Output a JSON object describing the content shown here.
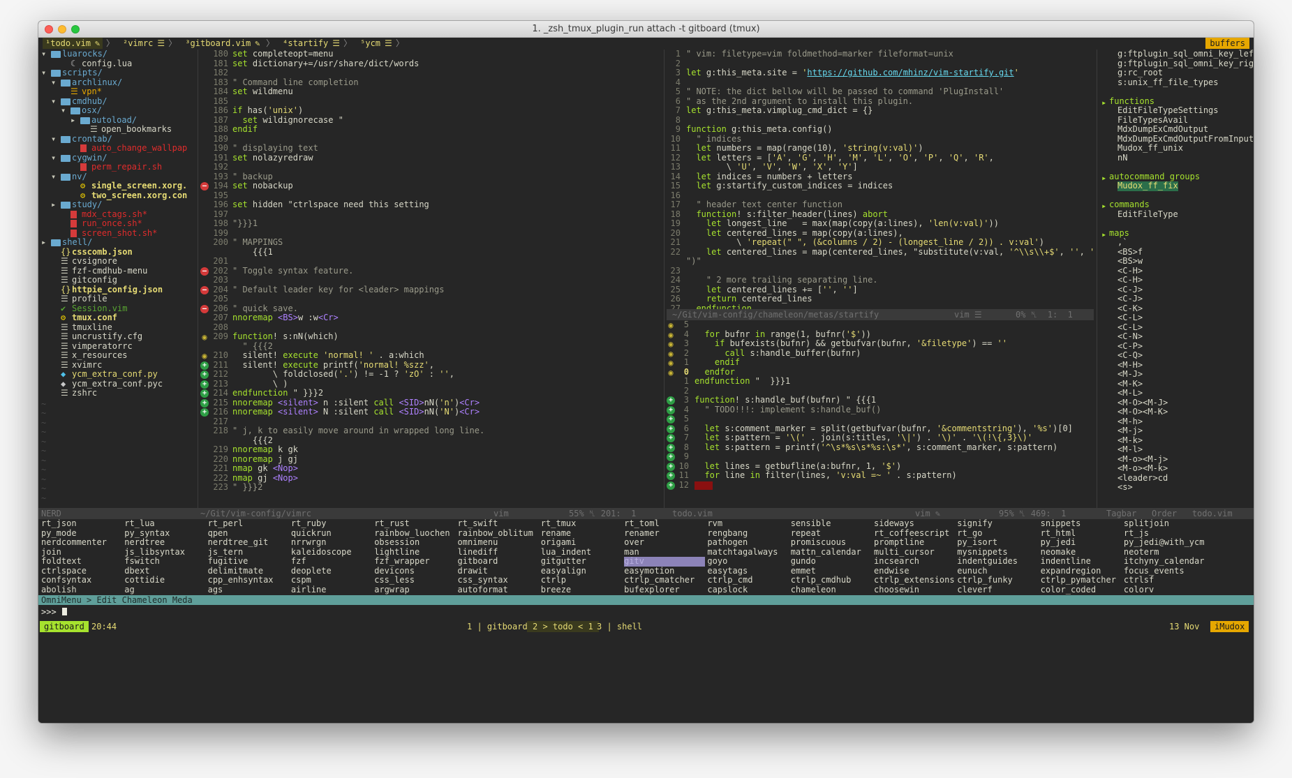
{
  "window": {
    "title": "1. _zsh_tmux_plugin_run attach -t gitboard (tmux)"
  },
  "tabline": {
    "tabs": [
      {
        "label": "¹todo.vim",
        "icon": "✎",
        "active": true
      },
      {
        "label": "²vimrc",
        "icon": "☰",
        "active": false
      },
      {
        "label": "³gitboard.vim",
        "icon": "✎",
        "active": false
      },
      {
        "label": "⁴startify",
        "icon": "☰",
        "active": false
      },
      {
        "label": "⁵ycm",
        "icon": "☰",
        "active": false
      }
    ],
    "right_label": "buffers"
  },
  "nerdtree": {
    "rows": [
      {
        "indent": 0,
        "arrow": "▾",
        "kind": "folder",
        "label": "luarocks/"
      },
      {
        "indent": 2,
        "arrow": "",
        "kind": "lua",
        "label": "config.lua"
      },
      {
        "indent": 0,
        "arrow": "▾",
        "kind": "folder",
        "label": "scripts/"
      },
      {
        "indent": 1,
        "arrow": "▾",
        "kind": "folder",
        "label": "archlinux/"
      },
      {
        "indent": 2,
        "arrow": "",
        "kind": "doc-y",
        "label": "vpn*"
      },
      {
        "indent": 1,
        "arrow": "▾",
        "kind": "folder",
        "label": "cmdhub/"
      },
      {
        "indent": 2,
        "arrow": "▾",
        "kind": "folder",
        "label": "osx/"
      },
      {
        "indent": 3,
        "arrow": "▸",
        "kind": "folder",
        "label": "autoload/"
      },
      {
        "indent": 4,
        "arrow": "",
        "kind": "doc",
        "label": "open_bookmarks"
      },
      {
        "indent": 1,
        "arrow": "▾",
        "kind": "folder",
        "label": "crontab/"
      },
      {
        "indent": 3,
        "arrow": "",
        "kind": "red",
        "label": "auto_change_wallpap"
      },
      {
        "indent": 1,
        "arrow": "▾",
        "kind": "folder",
        "label": "cygwin/"
      },
      {
        "indent": 3,
        "arrow": "",
        "kind": "red",
        "label": "perm_repair.sh"
      },
      {
        "indent": 1,
        "arrow": "▾",
        "kind": "folder",
        "label": "nv/"
      },
      {
        "indent": 3,
        "arrow": "",
        "kind": "gear",
        "label": "single_screen.xorg."
      },
      {
        "indent": 3,
        "arrow": "",
        "kind": "gear",
        "label": "two_screen.xorg.con"
      },
      {
        "indent": 1,
        "arrow": "▸",
        "kind": "folder",
        "label": "study/"
      },
      {
        "indent": 2,
        "arrow": "",
        "kind": "red",
        "label": "mdx_ctags.sh*"
      },
      {
        "indent": 2,
        "arrow": "",
        "kind": "red",
        "label": "run_once.sh*"
      },
      {
        "indent": 2,
        "arrow": "",
        "kind": "red",
        "label": "screen_shot.sh*"
      },
      {
        "indent": 0,
        "arrow": "▸",
        "kind": "folder",
        "label": "shell/"
      },
      {
        "indent": 1,
        "arrow": "",
        "kind": "json",
        "label": "csscomb.json"
      },
      {
        "indent": 1,
        "arrow": "",
        "kind": "doc",
        "label": "cvsignore"
      },
      {
        "indent": 1,
        "arrow": "",
        "kind": "doc",
        "label": "fzf-cmdhub-menu"
      },
      {
        "indent": 1,
        "arrow": "",
        "kind": "doc",
        "label": "gitconfig"
      },
      {
        "indent": 1,
        "arrow": "",
        "kind": "json",
        "label": "httpie_config.json"
      },
      {
        "indent": 1,
        "arrow": "",
        "kind": "doc",
        "label": "profile"
      },
      {
        "indent": 1,
        "arrow": "",
        "kind": "vim",
        "label": "Session.vim"
      },
      {
        "indent": 1,
        "arrow": "",
        "kind": "gear",
        "label": "tmux.conf"
      },
      {
        "indent": 1,
        "arrow": "",
        "kind": "doc",
        "label": "tmuxline"
      },
      {
        "indent": 1,
        "arrow": "",
        "kind": "doc",
        "label": "uncrustify.cfg"
      },
      {
        "indent": 1,
        "arrow": "",
        "kind": "doc",
        "label": "vimperatorrc"
      },
      {
        "indent": 1,
        "arrow": "",
        "kind": "doc",
        "label": "x_resources"
      },
      {
        "indent": 1,
        "arrow": "",
        "kind": "doc",
        "label": "xvimrc"
      },
      {
        "indent": 1,
        "arrow": "",
        "kind": "py",
        "label": "ycm_extra_conf.py"
      },
      {
        "indent": 1,
        "arrow": "",
        "kind": "py2",
        "label": "ycm_extra_conf.pyc"
      },
      {
        "indent": 1,
        "arrow": "",
        "kind": "doc",
        "label": "zshrc"
      }
    ],
    "tildes": [
      "~",
      "~",
      "~",
      "~",
      "~",
      "~",
      "~",
      "~",
      "~",
      "~",
      "~"
    ],
    "status": "NERD"
  },
  "vimrc": {
    "lines": [
      {
        "n": "180",
        "s": "",
        "t": "set completeopt=menu"
      },
      {
        "n": "181",
        "s": "",
        "t": "set dictionary+=/usr/share/dict/words"
      },
      {
        "n": "182",
        "s": "",
        "t": ""
      },
      {
        "n": "183",
        "s": "",
        "t": "\" Command line completion"
      },
      {
        "n": "184",
        "s": "",
        "t": "set wildmenu"
      },
      {
        "n": "185",
        "s": "",
        "t": ""
      },
      {
        "n": "186",
        "s": "",
        "t": "if has('unix')"
      },
      {
        "n": "187",
        "s": "",
        "t": "  set wildignorecase \""
      },
      {
        "n": "188",
        "s": "",
        "t": "endif"
      },
      {
        "n": "189",
        "s": "",
        "t": ""
      },
      {
        "n": "190",
        "s": "",
        "t": "\" displaying text"
      },
      {
        "n": "191",
        "s": "",
        "t": "set nolazyredraw"
      },
      {
        "n": "192",
        "s": "",
        "t": ""
      },
      {
        "n": "193",
        "s": "",
        "t": "\" backup"
      },
      {
        "n": "194",
        "s": "r",
        "t": "set nobackup"
      },
      {
        "n": "195",
        "s": "",
        "t": ""
      },
      {
        "n": "196",
        "s": "",
        "t": "set hidden \"ctrlspace need this setting"
      },
      {
        "n": "197",
        "s": "",
        "t": ""
      },
      {
        "n": "198",
        "s": "",
        "t": "\"}}}1"
      },
      {
        "n": "199",
        "s": "",
        "t": ""
      },
      {
        "n": "200",
        "s": "",
        "t": "\" MAPPINGS"
      },
      {
        "n": "",
        "s": "",
        "t": "    {{{1"
      },
      {
        "n": "201",
        "s": "",
        "t": ""
      },
      {
        "n": "202",
        "s": "r",
        "t": "\" Toggle syntax feature."
      },
      {
        "n": "203",
        "s": "",
        "t": ""
      },
      {
        "n": "204",
        "s": "r",
        "t": "\" Default leader key for <leader> mappings"
      },
      {
        "n": "205",
        "s": "",
        "t": ""
      },
      {
        "n": "206",
        "s": "r",
        "t": "\" quick save."
      },
      {
        "n": "207",
        "s": "",
        "t": "nnoremap <BS>w :w<Cr>"
      },
      {
        "n": "208",
        "s": "",
        "t": ""
      },
      {
        "n": "209",
        "s": "e",
        "t": "function! s:nN(which)"
      },
      {
        "n": "",
        "s": "",
        "t": "  \" {{{2"
      },
      {
        "n": "210",
        "s": "e",
        "t": "  silent! execute 'normal! ' . a:which"
      },
      {
        "n": "211",
        "s": "g",
        "t": "  silent! execute printf('normal! %szz',"
      },
      {
        "n": "212",
        "s": "g",
        "t": "        \\ foldclosed('.') != -1 ? 'zO' : '',"
      },
      {
        "n": "213",
        "s": "g",
        "t": "        \\ )"
      },
      {
        "n": "214",
        "s": "g",
        "t": "endfunction \" }}}2"
      },
      {
        "n": "215",
        "s": "g",
        "t": "nnoremap <silent> n :silent call <SID>nN('n')<Cr>"
      },
      {
        "n": "216",
        "s": "g",
        "t": "nnoremap <silent> N :silent call <SID>nN('N')<Cr>"
      },
      {
        "n": "217",
        "s": "",
        "t": ""
      },
      {
        "n": "218",
        "s": "",
        "t": "\" j, k to easily move around in wrapped long line."
      },
      {
        "n": "",
        "s": "",
        "t": "    {{{2"
      },
      {
        "n": "219",
        "s": "",
        "t": "nnoremap k gk"
      },
      {
        "n": "220",
        "s": "",
        "t": "nnoremap j gj"
      },
      {
        "n": "221",
        "s": "",
        "t": "nmap gk <Nop>"
      },
      {
        "n": "222",
        "s": "",
        "t": "nmap gj <Nop>"
      },
      {
        "n": "223",
        "s": "",
        "t": "\" }}}2"
      }
    ],
    "status_path": "~/Git/vim-config/vimrc",
    "status_ft": "vim",
    "status_pos": "55% ␤ 201:  1"
  },
  "startify_meta": {
    "lines": [
      {
        "n": "1",
        "t": "\" vim: filetype=vim foldmethod=marker fileformat=unix"
      },
      {
        "n": "2",
        "t": ""
      },
      {
        "n": "3",
        "t": "let g:this_meta.site = 'https://github.com/mhinz/vim-startify.git'"
      },
      {
        "n": "4",
        "t": ""
      },
      {
        "n": "5",
        "t": "\" NOTE: the dict bellow will be passed to command 'PlugInstall'"
      },
      {
        "n": "6",
        "t": "\" as the 2nd argument to install this plugin."
      },
      {
        "n": "7",
        "t": "let g:this_meta.vimplug_cmd_dict = {}"
      },
      {
        "n": "8",
        "t": ""
      },
      {
        "n": "9",
        "t": "function g:this_meta.config()"
      },
      {
        "n": "10",
        "t": "  \" indices"
      },
      {
        "n": "11",
        "t": "  let numbers = map(range(10), 'string(v:val)')"
      },
      {
        "n": "12",
        "t": "  let letters = ['A', 'G', 'H', 'M', 'L', 'O', 'P', 'Q', 'R',"
      },
      {
        "n": "13",
        "t": "        \\ 'U', 'V', 'W', 'X', 'Y']"
      },
      {
        "n": "14",
        "t": "  let indices = numbers + letters"
      },
      {
        "n": "15",
        "t": "  let g:startify_custom_indices = indices"
      },
      {
        "n": "16",
        "t": ""
      },
      {
        "n": "17",
        "t": "  \" header text center function"
      },
      {
        "n": "18",
        "t": "  function! s:filter_header(lines) abort"
      },
      {
        "n": "19",
        "t": "    let longest_line   = max(map(copy(a:lines), 'len(v:val)'))"
      },
      {
        "n": "20",
        "t": "    let centered_lines = map(copy(a:lines),"
      },
      {
        "n": "21",
        "t": "          \\ 'repeat(\" \", (&columns / 2) - (longest_line / 2)) . v:val')"
      },
      {
        "n": "22",
        "t": "    let centered_lines = map(centered_lines, \"substitute(v:val, '^\\\\s\\\\+$', '', '')"
      },
      {
        "n": "",
        "t": "\")\""
      },
      {
        "n": "23",
        "t": ""
      },
      {
        "n": "24",
        "t": "    \" 2 more trailing separating line."
      },
      {
        "n": "25",
        "t": "    let centered_lines += ['', '']"
      },
      {
        "n": "26",
        "t": "    return centered_lines"
      },
      {
        "n": "27",
        "t": "  endfunction"
      }
    ],
    "status_path": "~/Git/vim-config/chameleon/metas/startify",
    "status_ft": "vim ☰",
    "status_pos": "0% ␤  1:  1"
  },
  "todo": {
    "lines": [
      {
        "n": "5",
        "s": "e",
        "t": ""
      },
      {
        "n": "4",
        "s": "e",
        "t": "  for bufnr in range(1, bufnr('$'))"
      },
      {
        "n": "3",
        "s": "e",
        "t": "    if bufexists(bufnr) && getbufvar(bufnr, '&filetype') == ''"
      },
      {
        "n": "2",
        "s": "e",
        "t": "      call s:handle_buffer(bufnr)"
      },
      {
        "n": "1",
        "s": "e",
        "t": "    endif"
      },
      {
        "n": "0",
        "s": "e",
        "t": "  endfor"
      },
      {
        "n": "1",
        "s": "",
        "t": "endfunction \"  }}}1"
      },
      {
        "n": "2",
        "s": "",
        "t": ""
      },
      {
        "n": "3",
        "s": "g",
        "t": "function! s:handle_buf(bufnr) \" {{{1"
      },
      {
        "n": "4",
        "s": "g",
        "t": "  \" TODO!!!: implement s:handle_buf()"
      },
      {
        "n": "5",
        "s": "g",
        "t": ""
      },
      {
        "n": "6",
        "s": "g",
        "t": "  let s:comment_marker = split(getbufvar(bufnr, '&commentstring'), '%s')[0]"
      },
      {
        "n": "7",
        "s": "g",
        "t": "  let s:pattern = '\\(' . join(s:titles, '\\|') . '\\)' . '\\(!\\{,3}\\)'"
      },
      {
        "n": "8",
        "s": "g",
        "t": "  let s:pattern = printf('^\\s*%s\\s*%s:\\s*', s:comment_marker, s:pattern)"
      },
      {
        "n": "9",
        "s": "g",
        "t": ""
      },
      {
        "n": "10",
        "s": "g",
        "t": "  let lines = getbufline(a:bufnr, 1, '$')"
      },
      {
        "n": "11",
        "s": "g",
        "t": "  for line in filter(lines, 'v:val =~ ' . s:pattern)"
      },
      {
        "n": "12",
        "s": "g",
        "t": ""
      }
    ],
    "status_path": "todo.vim",
    "status_ft": "vim ✎",
    "status_pos": "95% ␤ 469:  1"
  },
  "tagbar": {
    "top_items": [
      "g:ftplugin_sql_omni_key_left",
      "g:ftplugin_sql_omni_key_right",
      "g:rc_root",
      "s:unix_ff_file_types"
    ],
    "functions_label": "functions",
    "functions": [
      "EditFileTypeSettings",
      "FileTypesAvail",
      "MdxDumpExCmdOutput",
      "MdxDumpExCmdOutputFromInput",
      "Mudox_ff_unix",
      "nN"
    ],
    "autocmd_label": "autocommand groups",
    "autocmd": [
      "Mudox_ff_fix"
    ],
    "commands_label": "commands",
    "commands": [
      "EditFileType"
    ],
    "maps_label": "maps",
    "maps": [
      ",`",
      "<BS>f",
      "<BS>w",
      "<C-H>",
      "<C-H>",
      "<C-J>",
      "<C-J>",
      "<C-K>",
      "<C-L>",
      "<C-L>",
      "<C-N>",
      "<C-P>",
      "<C-Q>",
      "<M-H>",
      "<M-J>",
      "<M-K>",
      "<M-L>",
      "<M-O><M-J>",
      "<M-O><M-K>",
      "<M-h>",
      "<M-j>",
      "<M-k>",
      "<M-l>",
      "<M-o><M-j>",
      "<M-o><M-k>",
      "<leader>cd",
      "<s>"
    ],
    "status": "Tagbar   Order   todo.vim"
  },
  "plugins": {
    "columns": [
      [
        "rt_json",
        "py_mode",
        "nerdcommenter",
        "join",
        "foldtext",
        "ctrlspace",
        "confsyntax",
        "abolish"
      ],
      [
        "rt_lua",
        "py_syntax",
        "nerdtree",
        "js_libsyntax",
        "fswitch",
        "dbext",
        "cottidie",
        "ag"
      ],
      [
        "rt_perl",
        "qpen",
        "nerdtree_git",
        "js_tern",
        "fugitive",
        "delimitmate",
        "cpp_enhsyntax",
        "ags"
      ],
      [
        "rt_ruby",
        "quickrun",
        "nrrwrgn",
        "kaleidoscope",
        "fzf",
        "deoplete",
        "cspm",
        "airline"
      ],
      [
        "rt_rust",
        "rainbow_luochen",
        "obsession",
        "lightline",
        "fzf_wrapper",
        "devicons",
        "css_less",
        "argwrap"
      ],
      [
        "rt_swift",
        "rainbow_oblitum",
        "omnimenu",
        "linediff",
        "gitboard",
        "drawit",
        "css_syntax",
        "autoformat"
      ],
      [
        "rt_tmux",
        "rename",
        "origami",
        "lua_indent",
        "gitgutter",
        "easyalign",
        "ctrlp",
        "breeze"
      ],
      [
        "rt_toml",
        "renamer",
        "over",
        "man",
        "gitv",
        "easymotion",
        "ctrlp_cmatcher",
        "bufexplorer"
      ],
      [
        "rvm",
        "rengbang",
        "pathogen",
        "matchtagalways",
        "goyo",
        "easytags",
        "ctrlp_cmd",
        "capslock"
      ],
      [
        "sensible",
        "repeat",
        "promiscuous",
        "mattn_calendar",
        "gundo",
        "emmet",
        "ctrlp_cmdhub",
        "chameleon"
      ],
      [
        "sideways",
        "rt_coffeescript",
        "promptline",
        "multi_cursor",
        "incsearch",
        "endwise",
        "ctrlp_extensions",
        "choosewin"
      ],
      [
        "signify",
        "rt_go",
        "py_isort",
        "mysnippets",
        "indentguides",
        "eunuch",
        "ctrlp_funky",
        "cleverf"
      ],
      [
        "snippets",
        "rt_html",
        "py_jedi",
        "neomake",
        "indentline",
        "expandregion",
        "ctrlp_pymatcher",
        "color_coded"
      ],
      [
        "splitjoin",
        "rt_js",
        "py_jedi@with_ycm",
        "neoterm",
        "itchyny_calendar",
        "focus_events",
        "ctrlsf",
        "colorv"
      ]
    ],
    "selected": "gitv"
  },
  "cmdline": {
    "omnimenu": "OmniMenu > Edit Chameleon Meda",
    "prompt": ">>>"
  },
  "tmux": {
    "session": "gitboard",
    "time": "20:44",
    "win1": "1 | gitboard",
    "win2": "2 > todo < 1",
    "win3": "3 | shell",
    "date": "13 Nov",
    "host": "iMudox"
  },
  "colors": {
    "accent_green": "#a6e22e",
    "yellow": "#e6db74",
    "pink": "#f92672",
    "purple": "#ae81ff",
    "cyan": "#66d9ef",
    "bg": "#262626"
  }
}
